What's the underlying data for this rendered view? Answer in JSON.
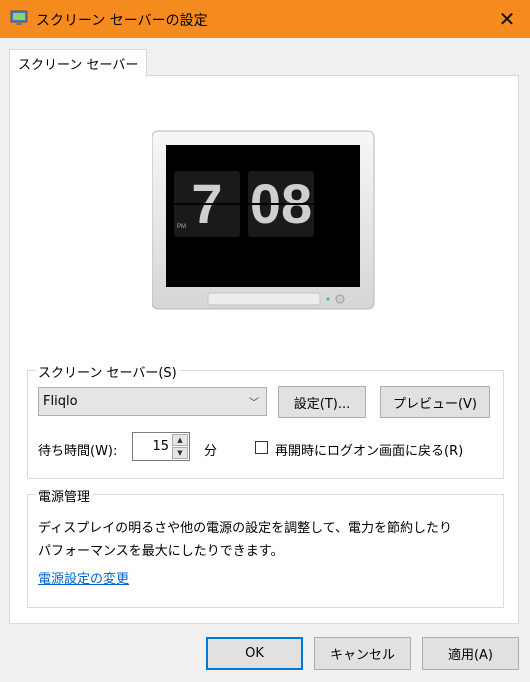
{
  "window": {
    "title": "スクリーン セーバーの設定",
    "close_glyph": "✕"
  },
  "tab": {
    "label": "スクリーン セーバー"
  },
  "preview": {
    "hour": "7",
    "minute": "08",
    "ampm": "PM"
  },
  "screensaver": {
    "group_label": "スクリーン セーバー(S)",
    "selected": "Fliqlo",
    "settings_button": "設定(T)...",
    "preview_button": "プレビュー(V)",
    "wait_label": "待ち時間(W):",
    "wait_value": "15",
    "wait_unit": "分",
    "resume_checkbox_label": "再開時にログオン画面に戻る(R)",
    "resume_checked": false
  },
  "power": {
    "group_label": "電源管理",
    "description_line1": "ディスプレイの明るさや他の電源の設定を調整して、電力を節約したり",
    "description_line2": "パフォーマンスを最大にしたりできます。",
    "link": "電源設定の変更"
  },
  "footer": {
    "ok": "OK",
    "cancel": "キャンセル",
    "apply": "適用(A)"
  },
  "colors": {
    "titlebar": "#f58b1f",
    "focus_border": "#0078d7",
    "link": "#0066cc"
  }
}
